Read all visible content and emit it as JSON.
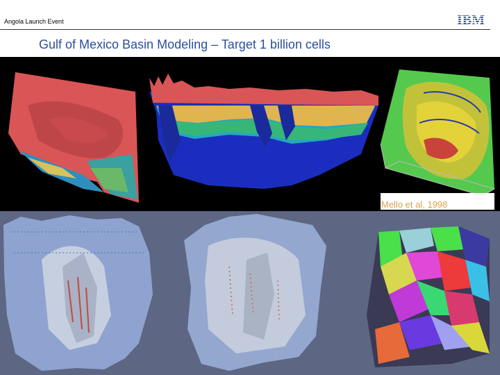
{
  "header": {
    "event_label": "Angola Launch Event",
    "logo_text": "IBM",
    "logo_icon": "ibm-striped-logo",
    "rule_color": "#333333"
  },
  "slide": {
    "title": "Gulf of Mexico Basin Modeling – Target 1 billion cells",
    "title_color": "#2a4ea0"
  },
  "figures": {
    "top_panel_background": "#000000",
    "bottom_panel_background": "#5d6683",
    "caption": "Mello et al, 1998",
    "caption_color": "#d7a24a",
    "items": [
      {
        "icon": "basin-surface-render"
      },
      {
        "icon": "basin-cross-section-render"
      },
      {
        "icon": "basin-volume-box-render"
      },
      {
        "icon": "mesh-render-left"
      },
      {
        "icon": "mesh-render-center"
      },
      {
        "icon": "partition-render"
      }
    ]
  }
}
